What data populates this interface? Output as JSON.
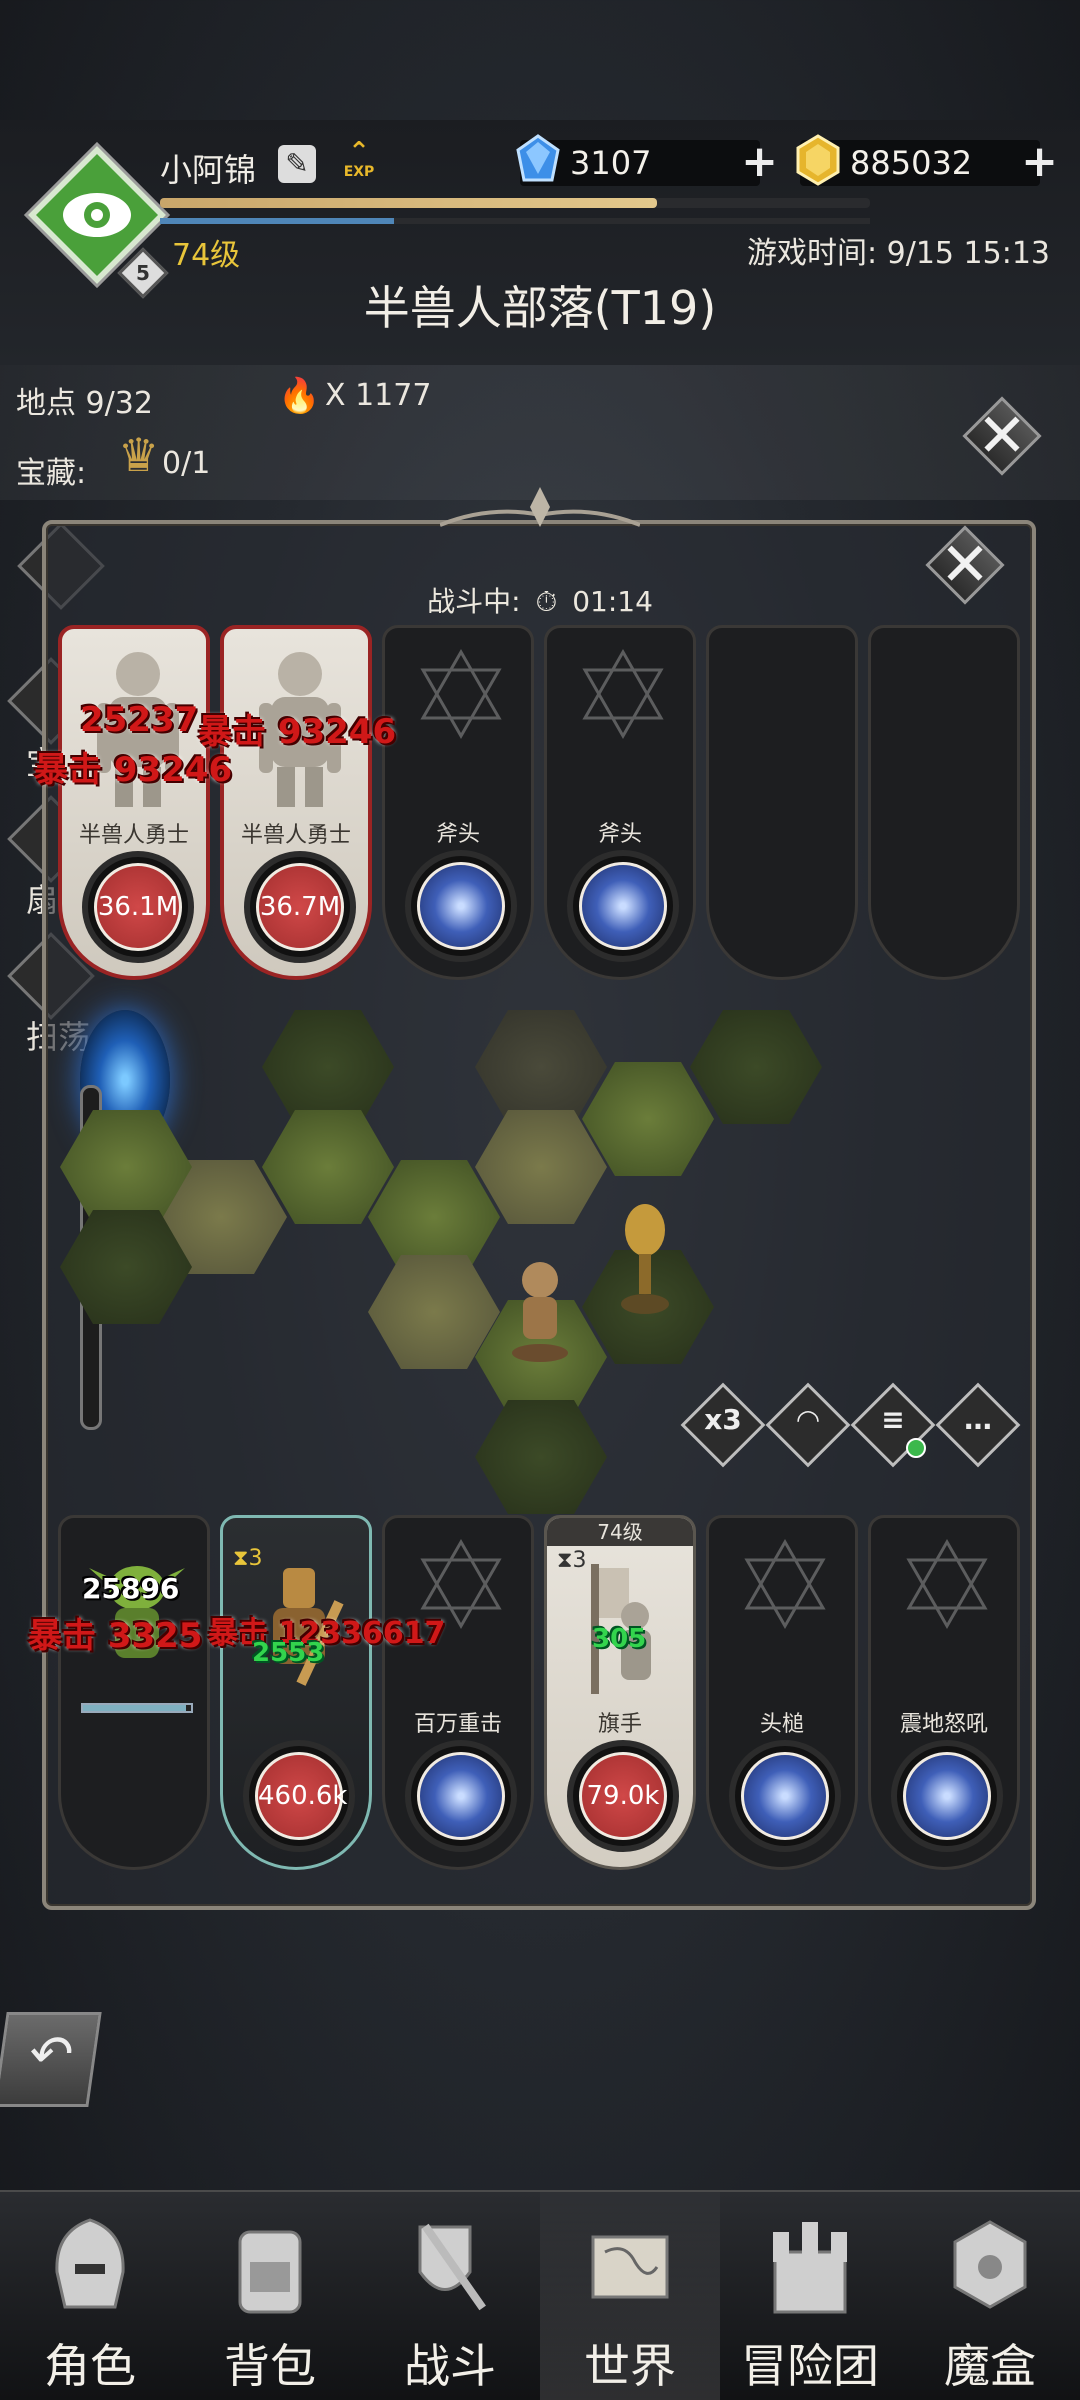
{
  "player": {
    "name": "小阿锦",
    "level_badge": "5",
    "level_text": "74级",
    "exp_label": "EXP",
    "xp_fraction": 0.7,
    "mp_fraction": 0.33
  },
  "resources": {
    "diamonds": "3107",
    "gold": "885032",
    "plus": "+"
  },
  "game_time": "游戏时间: 9/15 15:13",
  "zone_title": "半兽人部落(T19)",
  "info": {
    "locations": "地点 9/32",
    "torch_count": "X 1177",
    "treasure_label": "宝藏:",
    "treasure_count": "0/1"
  },
  "close_glyph": "✕",
  "battle": {
    "status_label": "战斗中:",
    "timer": "01:14"
  },
  "enemy_cards": [
    {
      "name": "半兽人勇士",
      "hp": "36.1M"
    },
    {
      "name": "半兽人勇士",
      "hp": "36.7M"
    },
    {
      "name": "斧头"
    },
    {
      "name": "斧头"
    }
  ],
  "enemy_damage": {
    "a1": "25237",
    "a2": "暴击 93246",
    "b1": "暴击 93246"
  },
  "ally_cards": [
    {
      "hp_percent": 0.95
    },
    {
      "hp": "460.6k"
    },
    {
      "name": "百万重击"
    },
    {
      "name": "旗手",
      "hp": "79.0k",
      "level": "74级"
    },
    {
      "name": "头槌"
    },
    {
      "name": "震地怒吼"
    }
  ],
  "ally_damage": {
    "w1": "25896",
    "c1": "暴击 3325",
    "c2": "暴击 12336617",
    "g1": "2553",
    "g2": "305"
  },
  "stack_badge": "3",
  "side_slider_value": "2",
  "controls": [
    "x3",
    "",
    "",
    "…"
  ],
  "left_menu": [
    "宝",
    "扇",
    "扫荡"
  ],
  "back_glyph": "↶",
  "nav": [
    {
      "label": "角色",
      "icon": "helmet-icon"
    },
    {
      "label": "背包",
      "icon": "backpack-icon"
    },
    {
      "label": "战斗",
      "icon": "shield-sword-icon"
    },
    {
      "label": "世界",
      "icon": "map-scroll-icon",
      "active": true
    },
    {
      "label": "冒险团",
      "icon": "castle-icon"
    },
    {
      "label": "魔盒",
      "icon": "cube-icon"
    }
  ],
  "colors": {
    "accent_gold": "#e8c53a",
    "enemy_red": "#9a2424",
    "crit_red": "#d01818",
    "heal_green": "#33d44d"
  }
}
